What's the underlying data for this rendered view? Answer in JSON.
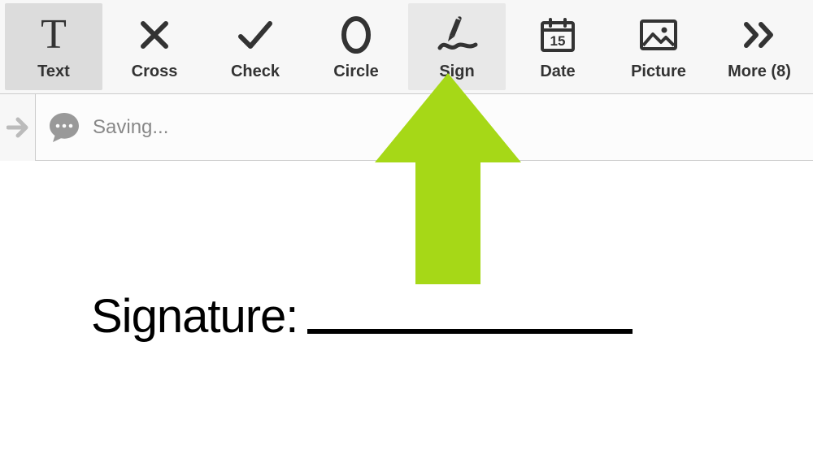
{
  "toolbar": {
    "items": [
      {
        "label": "Text"
      },
      {
        "label": "Cross"
      },
      {
        "label": "Check"
      },
      {
        "label": "Circle"
      },
      {
        "label": "Sign"
      },
      {
        "label": "Date"
      },
      {
        "label": "Picture"
      },
      {
        "label": "More (8)"
      }
    ]
  },
  "status": {
    "text": "Saving..."
  },
  "document": {
    "signature_label": "Signature:"
  },
  "accent": {
    "arrow_color": "#a6d817"
  }
}
